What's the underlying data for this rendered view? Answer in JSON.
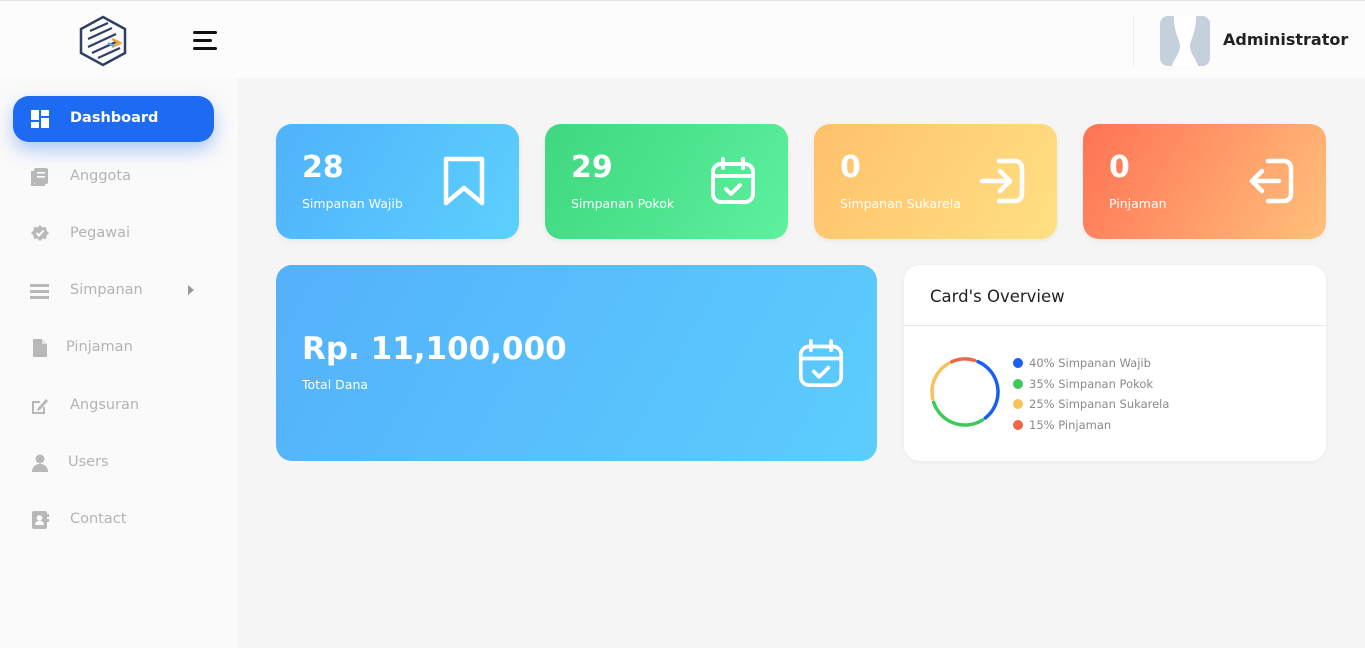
{
  "header": {
    "username": "Administrator"
  },
  "sidebar": {
    "items": [
      {
        "label": "Dashboard",
        "icon": "dashboard-icon",
        "active": true
      },
      {
        "label": "Anggota",
        "icon": "book-icon"
      },
      {
        "label": "Pegawai",
        "icon": "badge-check-icon"
      },
      {
        "label": "Simpanan",
        "icon": "list-icon",
        "has_submenu": true
      },
      {
        "label": "Pinjaman",
        "icon": "file-icon"
      },
      {
        "label": "Angsuran",
        "icon": "edit-icon"
      },
      {
        "label": "Users",
        "icon": "user-icon"
      },
      {
        "label": "Contact",
        "icon": "contact-book-icon"
      }
    ]
  },
  "stats": [
    {
      "value": "28",
      "label": "Simpanan Wajib",
      "icon": "bookmark-icon",
      "color_from": "#4fb2fb",
      "color_to": "#5dd0fd"
    },
    {
      "value": "29",
      "label": "Simpanan Pokok",
      "icon": "calendar-check-icon",
      "color_from": "#3fd77f",
      "color_to": "#5cf19e"
    },
    {
      "value": "0",
      "label": "Simpanan Sukarela",
      "icon": "login-icon",
      "color_from": "#ffc16b",
      "color_to": "#ffe083"
    },
    {
      "value": "0",
      "label": "Pinjaman",
      "icon": "logout-icon",
      "color_from": "#ff7254",
      "color_to": "#ffc17b"
    }
  ],
  "total": {
    "amount": "Rp. 11,100,000",
    "label": "Total Dana",
    "icon": "calendar-check-icon"
  },
  "overview": {
    "title": "Card's Overview",
    "legend": [
      {
        "label": "40% Simpanan Wajib",
        "percent": 40,
        "color": "#1a5ff0"
      },
      {
        "label": "35% Simpanan Pokok",
        "percent": 35,
        "color": "#3ec95b"
      },
      {
        "label": "25% Simpanan Sukarela",
        "percent": 25,
        "color": "#f8c15c"
      },
      {
        "label": "15% Pinjaman",
        "percent": 15,
        "color": "#f26644"
      }
    ]
  },
  "colors": {
    "accent": "#1c6bf2"
  }
}
